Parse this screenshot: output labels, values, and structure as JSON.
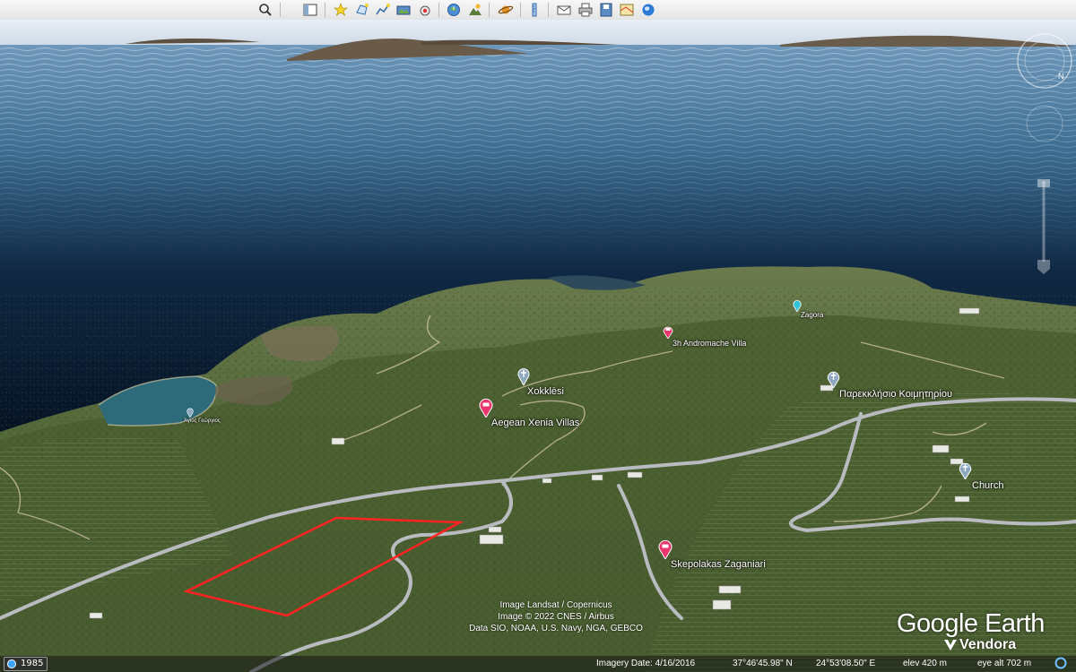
{
  "toolbar": {
    "buttons": [
      {
        "icon": "search-icon"
      },
      {
        "icon": "sidebar-icon"
      },
      {
        "icon": "placemark-icon"
      },
      {
        "icon": "polygon-icon"
      },
      {
        "icon": "path-icon"
      },
      {
        "icon": "image-overlay-icon"
      },
      {
        "icon": "record-tour-icon"
      },
      {
        "icon": "historical-imagery-icon"
      },
      {
        "icon": "sunlight-icon"
      },
      {
        "icon": "planets-icon"
      },
      {
        "icon": "ruler-icon"
      },
      {
        "icon": "email-icon"
      },
      {
        "icon": "print-icon"
      },
      {
        "icon": "save-image-icon"
      },
      {
        "icon": "maps-icon"
      },
      {
        "icon": "earth-icon"
      }
    ]
  },
  "places": {
    "zagora": "Zagora",
    "andromache": "3h Andromache Villa",
    "xokklesi": "Xokklēsi",
    "agios": "Άγιος Γεώργιος",
    "aegean": "Aegean Xenia Villas",
    "parekklisio": "Παρεκκλήσιο Κοιμητηρίου",
    "church": "Church",
    "skepolakas": "Skepolakas Zaganiari"
  },
  "attribution": {
    "line1": "Image Landsat / Copernicus",
    "line2": "Image © 2022 CNES / Airbus",
    "line3": "Data SIO, NOAA, U.S. Navy, NGA, GEBCO"
  },
  "logo": {
    "text": "Google Earth",
    "sub": "Vendora"
  },
  "status": {
    "history_year": "1985",
    "imagery_date": "Imagery Date: 4/16/2016",
    "lat": "37°46'45.98\" N",
    "lon": "24°53'08.50\" E",
    "elev": "elev  420 m",
    "eye_alt": "eye alt   702 m"
  },
  "colors": {
    "parcel_outline": "#ff2222",
    "poi_pin": "#e8356b",
    "church_pin": "#9fb4c8",
    "sea": "#3d6e92"
  }
}
